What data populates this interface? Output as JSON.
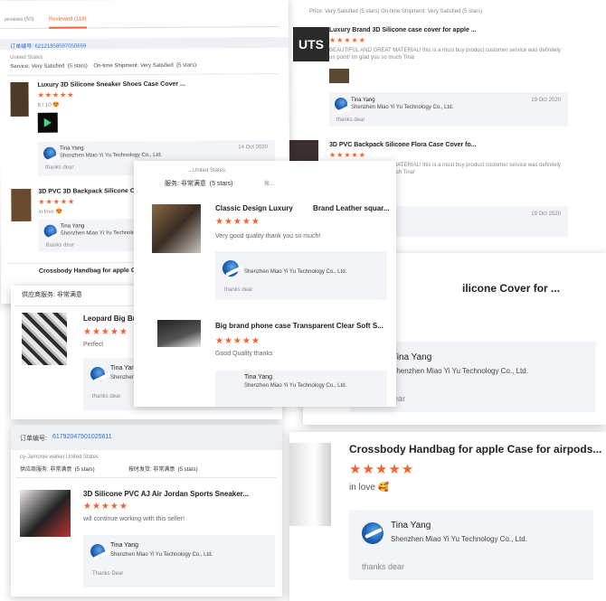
{
  "tabs": [
    {
      "label": "reviews (50)"
    },
    {
      "label": "Reviewed (118)"
    }
  ],
  "card1": {
    "order": "订单编号: 62121858597050659",
    "buyer_country": "United States",
    "ratings": "Service: Very Satisfied  (5 stars)    On-time Shipment: Very Satisfied  (5 stars)",
    "items": [
      {
        "title": "Luxury 3D Silicone Sneaker Shoes Case Cover ...",
        "stars": "★★★★★",
        "comment": "8 / 10 😍",
        "reply_name": "Tina Yang",
        "reply_company": "Shenzhen Miao Yi Yu Technology Co., Ltd.",
        "reply_date": "14 Oct 2020",
        "reply_text": "thanks dear"
      },
      {
        "title": "3D PVC 3D Backpack Silicone Cover for Apple ...",
        "stars": "★★★★★",
        "comment": "in love 😍",
        "reply_name": "Tina Yang",
        "reply_company": "Shenzhen Miao Yi Yu Technology Co., Ltd.",
        "reply_text": "thanks dear"
      },
      {
        "title": "Crossbody Handbag for apple Case for a"
      }
    ]
  },
  "card2": {
    "ratings_top": "Price: Very Satisfied  (5 stars)     On-time Shipment: Very Satisfied  (5 stars)",
    "items": [
      {
        "title": "Luxury Brand 3D Silicone case cover for apple ...",
        "stars": "★★★★★",
        "comment": "BEAUTIFUL AND GREAT MATERIAL! this is a must buy product customer service was definitely on point! Im glad you so much Tina!",
        "reply_name": "Tina Yang",
        "reply_company": "Shenzhen Miao Yi Yu Technology Co., Ltd.",
        "reply_date": "19 Oct 2020",
        "reply_text": "thanks dear"
      },
      {
        "title": "3D PVC Backpack Silicone Flora Case Cover fo...",
        "stars": "★★★★★",
        "comment": "BEAUTIFUL AND GREAT MATERIAL! this is a must buy product customer service was definitely on point! Im glad you so much Tina!",
        "reply_date": "19 Oct 2020"
      }
    ]
  },
  "card3": {
    "buyer": "...United States",
    "ratings": "服务: 非常满意  (5 stars)",
    "ratings_right": "按...",
    "items": [
      {
        "title": "Classic Design Luxury          Brand Leather squar...",
        "stars": "★★★★★",
        "comment": "Very good quality thank you so much!",
        "reply_company": "Shenzhen Miao Yi Yu Technology Co., Ltd.",
        "reply_text": "thanks dear"
      },
      {
        "title": "Big brand phone case Transparent Clear Soft S...",
        "stars": "★★★★★",
        "comment": "Good Quality thanks",
        "reply_name": "Tina Yang",
        "reply_company": "Shenzhen Miao Yi Yu Technology Co., Ltd."
      }
    ]
  },
  "card4": {
    "ratings": "供应商服务: 非常满意",
    "item": {
      "title": "Leopard Big Brand Lu",
      "stars": "★★★★★",
      "comment": "Perfect",
      "reply_name": "Tina Yang",
      "reply_company": "Shenzhen Miao Yi Yu Technology Co., Ltd.",
      "reply_text": "thanks dear"
    }
  },
  "card5": {
    "title_fragment": "ilicone Cover for ...",
    "reply_name": "Tina Yang",
    "reply_company": "Shenzhen Miao Yi Yu Technology Co., Ltd.",
    "reply_text": "thanks dear"
  },
  "card6": {
    "order_label": "订单编号:",
    "order_number": "61792047501025611",
    "buyer": "cy-Jamonie walker.United States",
    "rating_supplier": "供应商服务: 非常满意  (5 stars)",
    "rating_ship": "按时发货: 非常满意  (5 stars)",
    "item": {
      "title": "3D Silicone PVC AJ Air Jordan Sports Sneaker...",
      "stars": "★★★★★",
      "comment": "will continue working with this seller!",
      "reply_name": "Tina Yang",
      "reply_company": "Shenzhen Miao Yi Yu Technology Co., Ltd.",
      "reply_text": "Thanks Dear"
    }
  },
  "card7": {
    "title": "Crossbody Handbag for apple Case for airpods...",
    "stars": "★★★★★",
    "comment": "in love 🥰",
    "reply_name": "Tina Yang",
    "reply_company": "Shenzhen Miao Yi Yu Technology Co., Ltd.",
    "reply_text": "thanks dear"
  },
  "colors": {
    "accent": "#f5622b",
    "link": "#2c6fc9",
    "reply_bg": "#f3f4f7"
  },
  "icons": {
    "company_logo": "company-logo-icon"
  }
}
